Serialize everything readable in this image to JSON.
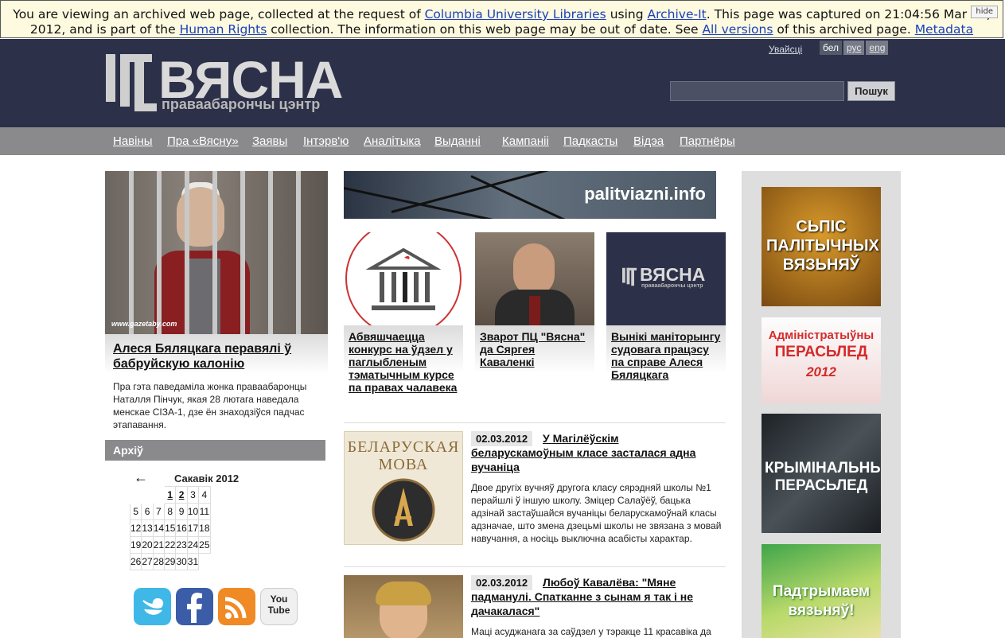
{
  "archive_banner": {
    "text1": "You are viewing an archived web page, collected at the request of ",
    "link1": "Columbia University Libraries",
    "text2": " using ",
    "link2": "Archive-It",
    "text3": ". This page was captured on 21:04:56 Mar 02, 2012, and is part of the ",
    "link3": "Human Rights",
    "text4": " collection. The information on this web page may be out of date. See ",
    "link4": "All versions",
    "text5": " of this archived page. ",
    "link5": "Metadata",
    "hide": "hide"
  },
  "header": {
    "logo_word": "ВЯСНА",
    "logo_sub": "праваабарончы цэнтр",
    "logout": "Увайсці",
    "langs": [
      "бел",
      "рус",
      "eng"
    ],
    "search_button": "Пошук"
  },
  "nav": [
    "Навіны",
    "Пра «Вясну»",
    "Заявы",
    "Інтэрв'ю",
    "Аналітыка",
    "Выданні",
    "Кампаніі",
    "Падкасты",
    "Відэа",
    "Партнёры"
  ],
  "feature": {
    "credit": "www.gazetaby.com",
    "title": "Алеся Бяляцкага перавялі ў бабруйскую калонію",
    "text": "Пра гэта паведаміла жонка праваабаронцы Наталля Пінчук, якая 28 лютага наведала менскае СІЗА-1, дзе ён знаходзіўся падчас этапавання."
  },
  "archive": {
    "title": "Архіў",
    "prev": "←",
    "month": "Сакавік 2012",
    "weeks": [
      [
        "",
        "",
        "",
        "1",
        "2",
        "3",
        "4"
      ],
      [
        "5",
        "6",
        "7",
        "8",
        "9",
        "10",
        "11"
      ],
      [
        "12",
        "13",
        "14",
        "15",
        "16",
        "17",
        "18"
      ],
      [
        "19",
        "20",
        "21",
        "22",
        "23",
        "24",
        "25"
      ],
      [
        "26",
        "27",
        "28",
        "29",
        "30",
        "31",
        ""
      ]
    ]
  },
  "social": [
    "twitter-icon",
    "facebook-icon",
    "rss-icon",
    "youtube-icon"
  ],
  "social_youtube": "You Tube",
  "promo": {
    "palitviazni": "palitviazni.info"
  },
  "thumbs": [
    {
      "title": "Абвяшчаецца конкурс на ўдзел у паглыбленым тэматычным курсе па правах чалавека"
    },
    {
      "title": "Зварот ПЦ \"Вясна\" да Сяргея Каваленкі"
    },
    {
      "title": "Вынікі маніторынгу судовага працэсу па справе Алеся Бяляцкага",
      "logo_word": "ВЯСНА",
      "logo_sub": "праваабарончы цэнтр"
    }
  ],
  "news": [
    {
      "date": "02.03.2012",
      "title": "У Магілёўскім беларускамоўным класе засталася адна вучаніца",
      "text": "Двое другіх вучняў другога класу сярэдняй школы №1 перайшлі ў іншую школу. Зміцер Салаўёў, бацька адзінай застаўшайся вучаніцы беларускамоўнай класы адзначае, што змена дзецьмі школы не звязана з мовай навучання, а носіць выключна асабісты характар.",
      "image_text": "БЕЛАРУСКАЯ МОВА"
    },
    {
      "date": "02.03.2012",
      "title": "Любоў Кавалёва: \"Мяне падманулі. Спатканне з сынам я так і не дачакалася\"",
      "text": "Маці асуджанага за саўдзел у тэракце 11 красавіка да"
    }
  ],
  "banners": [
    {
      "text": "СЬПІС ПАЛІТЫЧНЫХ ВЯЗЬНЯЎ"
    },
    {
      "text1": "Адміністратыўны",
      "text2": "ПЕРАСЬЛЕД",
      "text3": "2012"
    },
    {
      "text": "КРЫМІНАЛЬНЫ ПЕРАСЬЛЕД"
    },
    {
      "text": "Падтрымаем вязьняў!"
    }
  ],
  "colors": {
    "header_bg": "#2c3048",
    "nav_bg": "#8a8a8c",
    "banner_bg": "#fdfadf",
    "link_blue": "#1a3fbf"
  }
}
